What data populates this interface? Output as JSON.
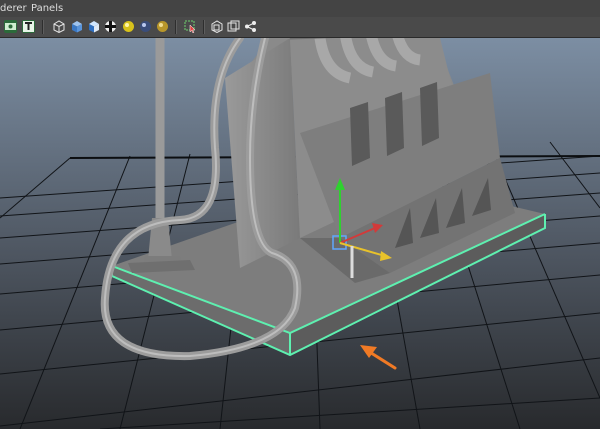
{
  "menu": {
    "renderer_label": "derer",
    "panels_label": "Panels"
  },
  "toolbar": {
    "icons": [
      "camera-attributes-icon",
      "text-icon",
      "wireframe-cube-icon",
      "smooth-shade-cube-icon",
      "textured-cube-icon",
      "checker-icon",
      "lights-sphere-icon",
      "shadows-sphere-icon",
      "reflection-sphere-icon",
      "isolate-select-icon",
      "xray-icon",
      "xray-joints-icon",
      "share-icon"
    ]
  },
  "viewport": {
    "colors": {
      "background_top": "#7c8ea3",
      "background_bottom": "#282a2d",
      "grid": "#111418",
      "model": "#8f8f8f",
      "selection": "#5ef0b0",
      "manip_y": "#2fd12f",
      "manip_x": "#d23a3a",
      "manip_z": "#e8c22b",
      "arrow": "#f07a25"
    }
  }
}
